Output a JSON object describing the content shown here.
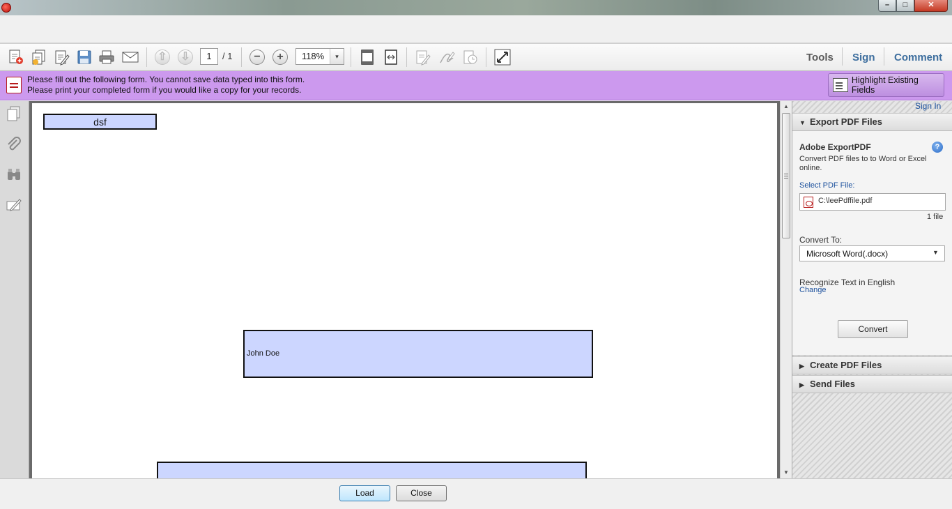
{
  "window": {
    "minimize_glyph": "–",
    "maximize_glyph": "□",
    "close_glyph": "✕"
  },
  "toolbar": {
    "page_current": "1",
    "page_total": "/ 1",
    "zoom": "118%",
    "zoom_arrow": "▾",
    "pane_links": {
      "tools": "Tools",
      "sign": "Sign",
      "comment": "Comment"
    },
    "icons": [
      "create-pdf-icon",
      "combine-files-icon",
      "edit-icon",
      "save-icon",
      "print-icon",
      "email-icon",
      "page-up-icon",
      "page-down-icon",
      "zoom-out-icon",
      "zoom-in-icon",
      "fit-page-icon",
      "fit-width-icon",
      "fill-sign-icon",
      "signature-icon",
      "certify-icon",
      "fullscreen-icon"
    ]
  },
  "message_bar": {
    "line1": "Please fill out the following form. You cannot save data typed into this form.",
    "line2": "Please print your completed form if you would like a copy for your records.",
    "highlight_button": "Highlight Existing Fields",
    "color": "#cc99ee"
  },
  "left_nav": {
    "icons": [
      "page-thumbnails-icon",
      "attachments-icon",
      "search-binoculars-icon",
      "signatures-icon"
    ]
  },
  "document": {
    "field1_value": "dsf",
    "field2_value": "John Doe",
    "field3_value": "",
    "field_color": "#ccd6ff"
  },
  "right_pane": {
    "sign_in": "Sign In",
    "export_section": "Export PDF Files",
    "export_title": "Adobe ExportPDF",
    "help_glyph": "?",
    "export_description": "Convert PDF files to to Word or Excel online.",
    "select_label": "Select PDF File:",
    "file_name": "C:\\leePdffile.pdf",
    "file_count": "1 file",
    "convert_to_label": "Convert To:",
    "convert_format": "Microsoft Word(.docx)",
    "format_arrow": "▼",
    "ocr_label": "Recognize Text in English",
    "ocr_change": "Change",
    "convert_button": "Convert",
    "create_section": "Create PDF Files",
    "send_section": "Send Files",
    "expanded_glyph": "▼",
    "collapsed_glyph": "▶"
  },
  "scrollbar": {
    "up_glyph": "▲",
    "down_glyph": "▼"
  },
  "bottom": {
    "load_button": "Load",
    "close_button": "Close"
  }
}
